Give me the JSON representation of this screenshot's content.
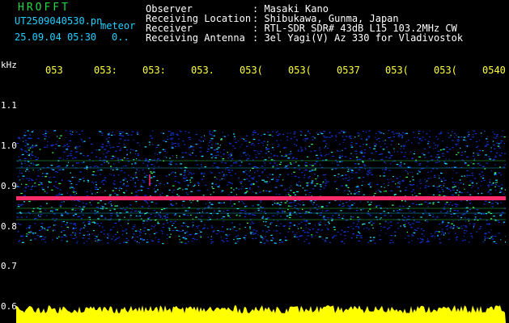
{
  "header": {
    "brand": "HROFFT",
    "filename": "UT2509040530.pn",
    "filename_suffix": "meteor",
    "datetime": "25.09.04 05:30",
    "counter": "0..",
    "info": [
      {
        "label": "Observer",
        "value": "Masaki Kano"
      },
      {
        "label": "Receiving Location",
        "value": "Shibukawa, Gunma, Japan"
      },
      {
        "label": "Receiver",
        "value": "RTL-SDR SDR# 43dB L15 103.2MHz CW"
      },
      {
        "label": "Receiving Antenna",
        "value": "3el Yagi(V) Az 330 for Vladivostok"
      }
    ]
  },
  "spectrogram": {
    "unit_label": "kHz",
    "time_ticks": [
      "053",
      "053:",
      "053:",
      "053.",
      "053(",
      "053(",
      "0537",
      "053(",
      "053(",
      "0540"
    ],
    "freq_ticks": [
      "1.1",
      "1.0",
      "0.9",
      "0.8",
      "0.7",
      "0.6"
    ],
    "colors": {
      "background": "#000000",
      "noise_blue": "#1030d0",
      "noise_cyan": "#20e0ff",
      "noise_green": "#40ff60",
      "carrier": "#ff2a6a",
      "yellow": "#ffff00"
    }
  }
}
